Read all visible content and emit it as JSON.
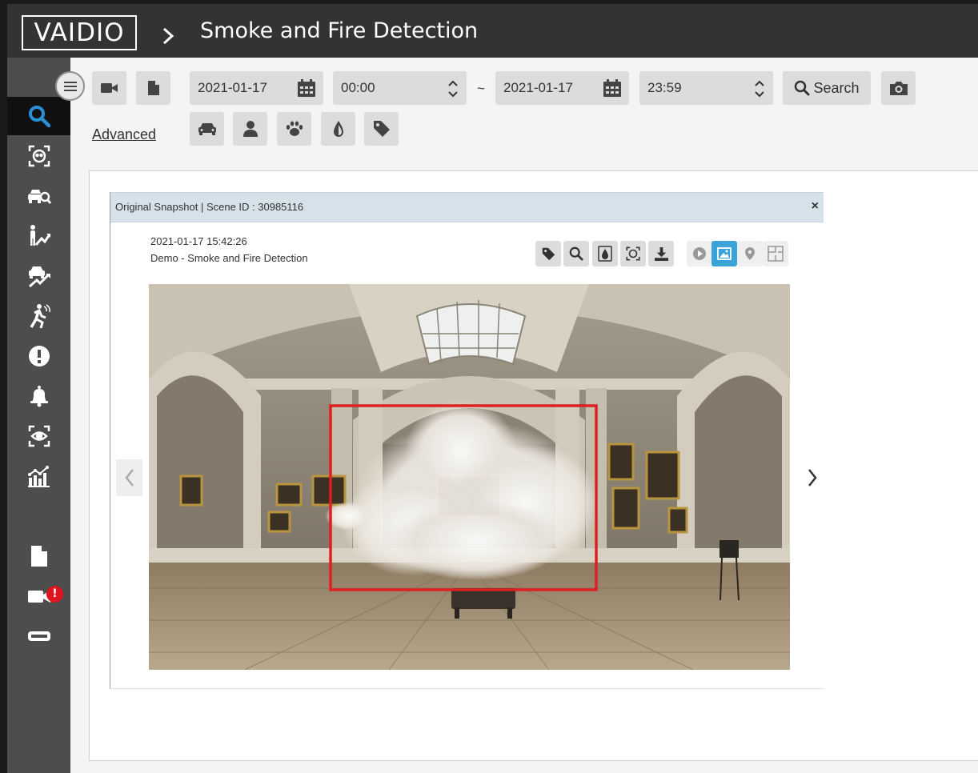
{
  "header": {
    "logo_text": "VAIDIO",
    "page_title": "Smoke and Fire Detection"
  },
  "sidebar": {
    "items": [
      {
        "icon": "search-icon",
        "active": true
      },
      {
        "icon": "face-recognition-icon"
      },
      {
        "icon": "vehicle-search-icon"
      },
      {
        "icon": "person-analytics-icon"
      },
      {
        "icon": "vehicle-analytics-icon"
      },
      {
        "icon": "running-person-icon"
      },
      {
        "icon": "alert-icon"
      },
      {
        "icon": "bell-icon"
      },
      {
        "icon": "eye-scan-icon"
      },
      {
        "icon": "chart-icon"
      },
      {
        "icon": "document-icon"
      },
      {
        "icon": "camera-icon"
      },
      {
        "icon": "storage-icon"
      }
    ],
    "camera_badge": "!"
  },
  "toolbar": {
    "start_date": "2021-01-17",
    "start_time": "00:00",
    "range_separator": "~",
    "end_date": "2021-01-17",
    "end_time": "23:59",
    "search_label": "Search",
    "advanced_label": "Advanced",
    "filters": [
      "car-icon",
      "person-icon",
      "paw-icon",
      "drop-icon",
      "tag-icon"
    ]
  },
  "snapshot": {
    "title": "Original Snapshot | Scene ID : 30985116",
    "close": "×",
    "timestamp": "2021-01-17 15:42:26",
    "camera": "Demo",
    "source_separator": " - ",
    "detection": "Smoke and Fire Detection",
    "actions": [
      "tag-icon",
      "zoom-icon",
      "smoke-icon",
      "face-icon",
      "download-icon"
    ],
    "view_modes": [
      "play-icon",
      "image-icon",
      "location-icon",
      "floorplan-icon"
    ],
    "selected_view": "image-icon"
  },
  "colors": {
    "header_bg": "#333333",
    "sidebar_bg": "#4d4d4d",
    "active_icon": "#2a8fd6",
    "selected_view": "#3ba3d8",
    "detection_box": "#e02020"
  }
}
